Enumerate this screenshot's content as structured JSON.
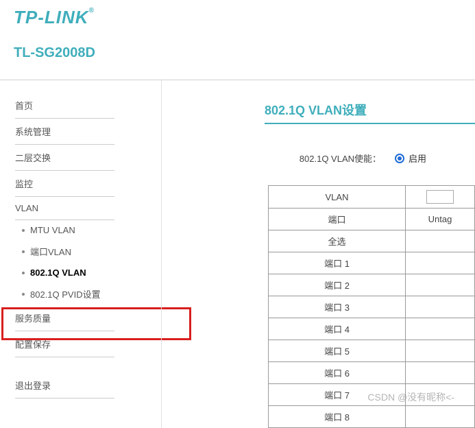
{
  "brand": "TP-LINK",
  "brand_reg": "®",
  "model": "TL-SG2008D",
  "nav": {
    "home": "首页",
    "system": "系统管理",
    "l2switch": "二层交换",
    "monitor": "监控",
    "vlan": "VLAN",
    "mtu_vlan": "MTU VLAN",
    "port_vlan": "端口VLAN",
    "q_vlan": "802.1Q VLAN",
    "pvid": "802.1Q PVID设置",
    "qos": "服务质量",
    "save": "配置保存",
    "logout": "退出登录"
  },
  "main": {
    "title": "802.1Q VLAN设置",
    "enable_label": "802.1Q VLAN使能：",
    "enable_opt": "启用",
    "table": {
      "th_vlan": "VLAN",
      "th_port": "端口",
      "th_untag": "Untag",
      "select_all": "全选",
      "rows": [
        "端口 1",
        "端口 2",
        "端口 3",
        "端口 4",
        "端口 5",
        "端口 6",
        "端口 7",
        "端口 8"
      ]
    }
  },
  "watermark": "CSDN @没有昵称<-"
}
